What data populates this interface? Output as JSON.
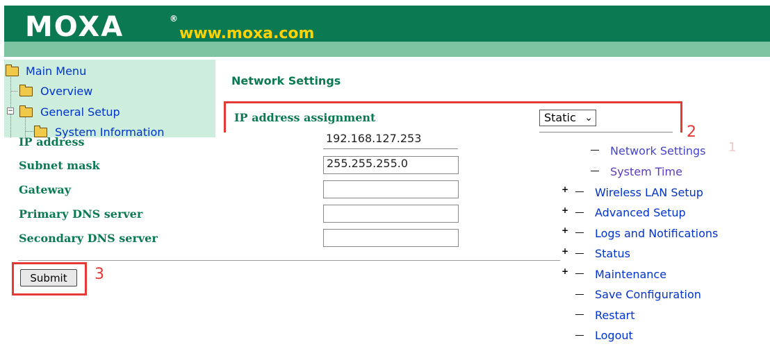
{
  "brand": {
    "logo_text": "MOXA",
    "logo_mark": "®",
    "site_url": "www.moxa.com"
  },
  "sidebar": {
    "items": [
      {
        "label": "Main Menu",
        "icon": "open-folder-icon"
      },
      {
        "label": "Overview",
        "icon": "folder-icon"
      },
      {
        "label": "General Setup",
        "icon": "open-folder-icon"
      },
      {
        "label": "System Information",
        "icon": "folder-icon"
      }
    ]
  },
  "main": {
    "section_title": "Network Settings",
    "ip_assignment": {
      "label": "IP address assignment",
      "value": "Static"
    },
    "fields": [
      {
        "label": "IP address",
        "value": "192.168.127.253"
      },
      {
        "label": "Subnet mask",
        "value": "255.255.255.0"
      },
      {
        "label": "Gateway",
        "value": ""
      },
      {
        "label": "Primary DNS server",
        "value": ""
      },
      {
        "label": "Secondary DNS server",
        "value": ""
      }
    ],
    "submit_label": "Submit"
  },
  "annotations": {
    "step2": "2",
    "step3": "3",
    "step1": "1"
  },
  "menu": {
    "items": [
      {
        "label": "Network Settings",
        "expandable": false,
        "active": true
      },
      {
        "label": "System Time",
        "expandable": false,
        "active": false
      },
      {
        "label": "Wireless LAN Setup",
        "expandable": true
      },
      {
        "label": "Advanced Setup",
        "expandable": true
      },
      {
        "label": "Logs and Notifications",
        "expandable": true
      },
      {
        "label": "Status",
        "expandable": true
      },
      {
        "label": "Maintenance",
        "expandable": true
      },
      {
        "label": "Save Configuration",
        "expandable": false
      },
      {
        "label": "Restart",
        "expandable": false
      },
      {
        "label": "Logout",
        "expandable": false
      }
    ]
  },
  "colors": {
    "header_green": "#0b7a52",
    "header_strip": "#7fc4a2",
    "sidebar_bg": "#cdeedd",
    "label_green": "#0b7a52",
    "link_blue": "#0033cc",
    "annotation_red": "#e53935",
    "url_yellow": "#ffd200"
  }
}
